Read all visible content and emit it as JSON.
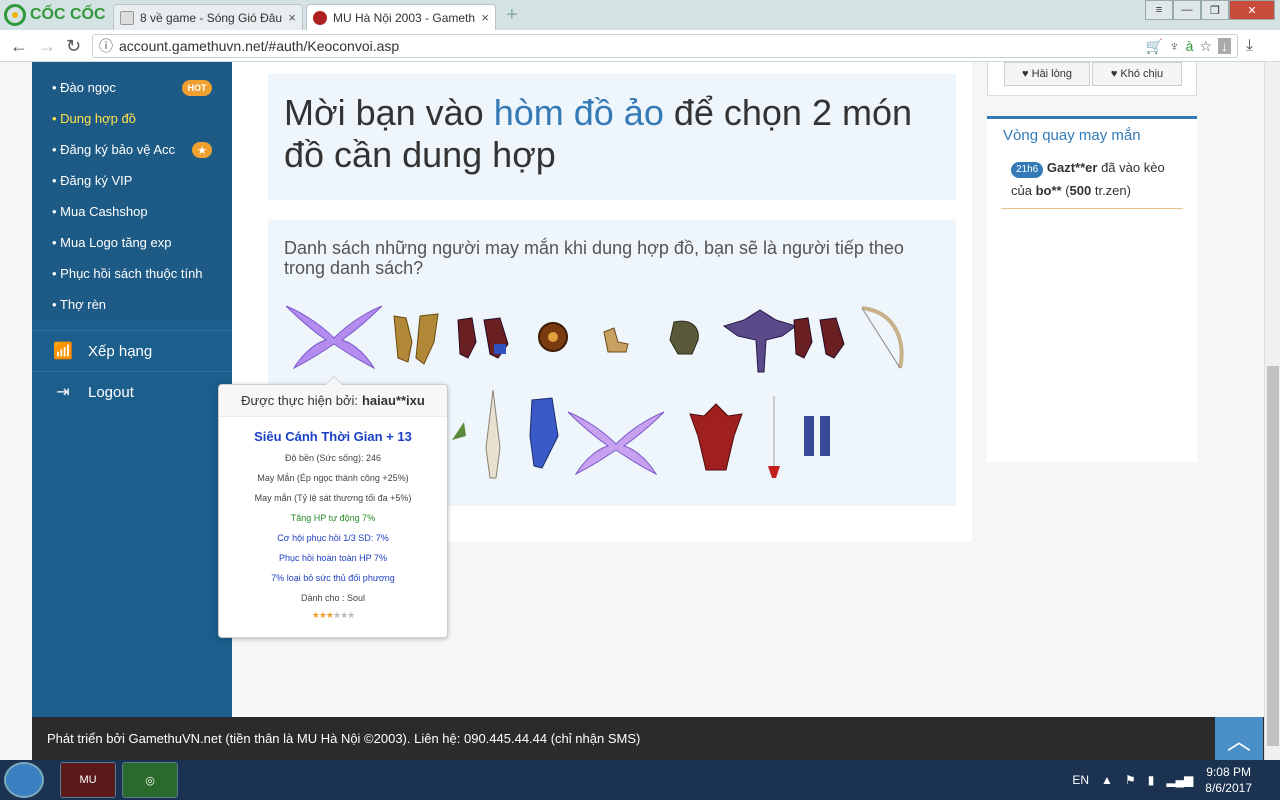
{
  "browser": {
    "brand": "CỐC CỐC",
    "tabs": [
      {
        "label": "8 về game - Sóng Gió Đâu",
        "close": "×"
      },
      {
        "label": "MU Hà Nội 2003 - Gameth",
        "close": "×"
      }
    ],
    "new_tab": "+",
    "url": "account.gamethuvn.net/#auth/Keoconvoi.asp"
  },
  "sidebar": {
    "items": [
      {
        "label": "• Đào ngọc",
        "badge": "HOT"
      },
      {
        "label": "• Dung hợp đồ",
        "active": true
      },
      {
        "label": "• Đăng ký bảo vệ Acc",
        "badge": "★"
      },
      {
        "label": "• Đăng ký VIP"
      },
      {
        "label": "• Mua Cashshop"
      },
      {
        "label": "• Mua Logo tăng exp"
      },
      {
        "label": "• Phục hồi sách thuộc tính"
      },
      {
        "label": "• Thợ rèn"
      }
    ],
    "ranking": "Xếp hạng",
    "logout": "Logout"
  },
  "main": {
    "heading_pre": "Mời bạn vào ",
    "heading_link": "hòm đồ ảo",
    "heading_post": " để chọn 2 món đồ cần dung hợp",
    "list_desc": "Danh sách những người may mắn khi dung hợp đồ, bạn sẽ là người tiếp theo trong danh sách?"
  },
  "reactions": {
    "like": "Hài lòng",
    "dislike": "Khó chịu"
  },
  "lucky": {
    "title": "Vòng quay may mắn",
    "time": "21h6",
    "user1": "Gazt**er",
    "text1": " đã vào kèo của ",
    "user2": "bo**",
    "amount": "500",
    "unit": " tr.zen)"
  },
  "tooltip": {
    "performed_by": "Được thực hiện bởi:",
    "user": "haiau**ixu",
    "item_name": "Siêu Cánh Thời Gian + 13",
    "lines": [
      {
        "text": "Độ bền (Sức sống): 246",
        "color": "gray"
      },
      {
        "text": "May Mắn (Ép ngọc thành công +25%)",
        "color": "gray"
      },
      {
        "text": "May mắn (Tỷ lệ sát thương tối đa +5%)",
        "color": "gray"
      },
      {
        "text": "Tăng HP tự động 7%",
        "color": "green"
      },
      {
        "text": "Cơ hội phục hồi 1/3 SD: 7%",
        "color": "blue"
      },
      {
        "text": "Phục hồi hoàn toàn HP 7%",
        "color": "blue"
      },
      {
        "text": "7% loại bỏ sức thủ đối phương",
        "color": "blue"
      },
      {
        "text": "Dành cho : Soul",
        "color": "gray"
      }
    ],
    "rating": 3,
    "rating_max": 6
  },
  "footer": {
    "text": "Phát triển bởi GamethuVN.net (tiền thân là MU Hà Nội ©2003). Liên hệ: 090.445.44.44 (chỉ nhận SMS)"
  },
  "taskbar": {
    "lang": "EN",
    "time": "9:08 PM",
    "date": "8/6/2017"
  },
  "colors": {
    "sidebar": "#1c5e8c",
    "accent": "#337ab7",
    "active_menu": "#ffe34a"
  }
}
